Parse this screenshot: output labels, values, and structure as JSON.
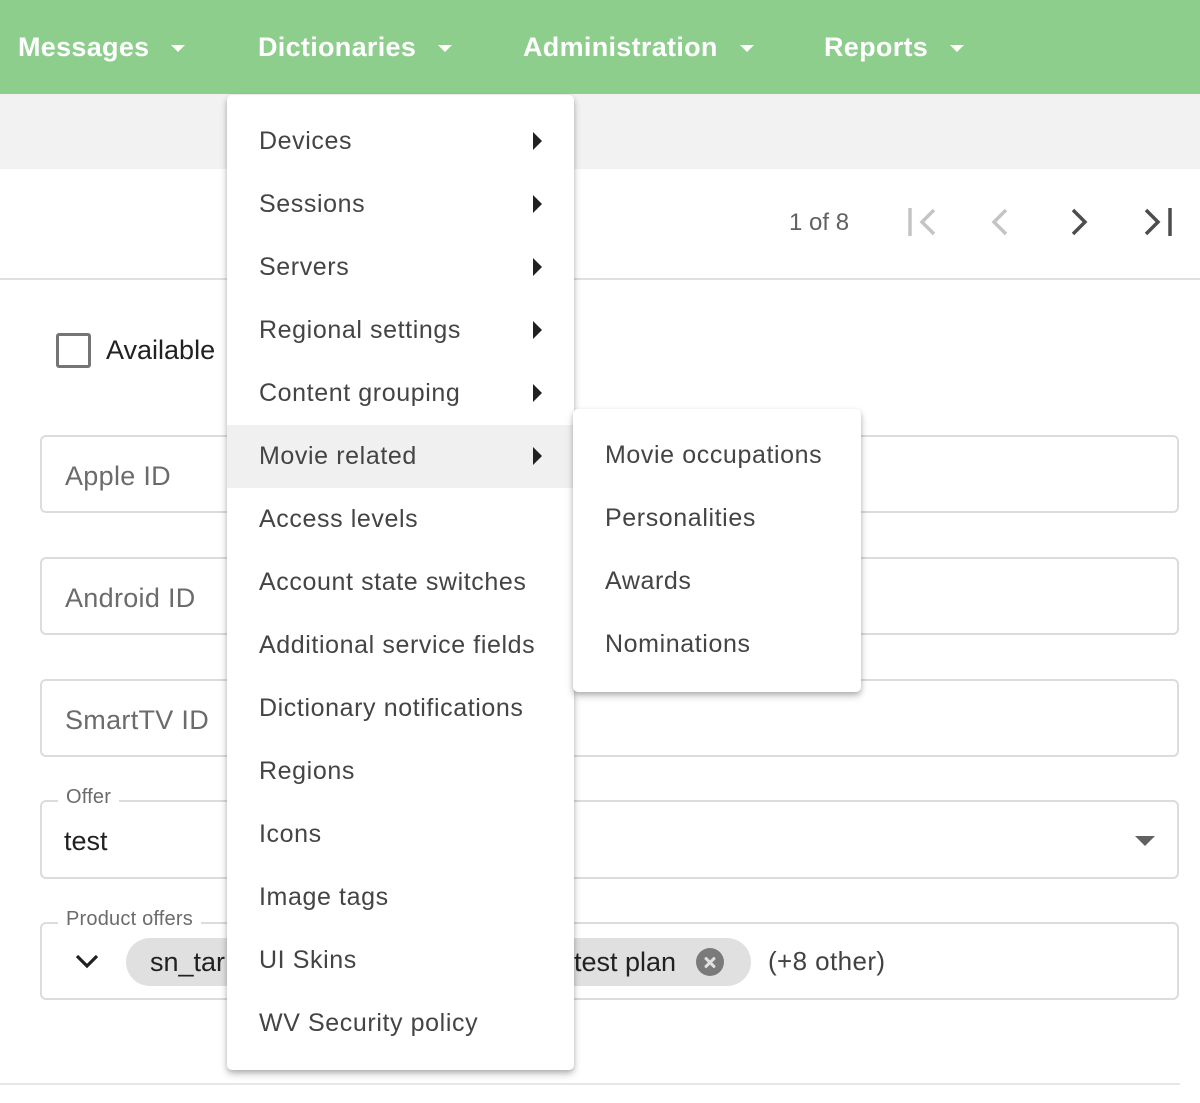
{
  "nav": {
    "items": [
      {
        "label": "Messages"
      },
      {
        "label": "Dictionaries"
      },
      {
        "label": "Administration"
      },
      {
        "label": "Reports"
      }
    ]
  },
  "paginator": {
    "label": "1 of 8",
    "icons": [
      "first-page-icon",
      "previous-page-icon",
      "next-page-icon",
      "last-page-icon"
    ]
  },
  "form": {
    "available_label": "Available",
    "available_checked": false,
    "apple_id_placeholder": "Apple ID",
    "android_id_placeholder": "Android ID",
    "smarttv_id_placeholder": "SmartTV ID",
    "offer": {
      "label": "Offer",
      "value": "test"
    },
    "product_offers": {
      "label": "Product offers",
      "chips": [
        {
          "label": "sn_tar"
        },
        {
          "label": "test plan"
        }
      ],
      "more": "(+8 other)"
    }
  },
  "dictionaries_menu": {
    "items": [
      {
        "label": "Devices",
        "has_submenu": true
      },
      {
        "label": "Sessions",
        "has_submenu": true
      },
      {
        "label": "Servers",
        "has_submenu": true
      },
      {
        "label": "Regional settings",
        "has_submenu": true
      },
      {
        "label": "Content grouping",
        "has_submenu": true
      },
      {
        "label": "Movie related",
        "has_submenu": true,
        "active": true
      },
      {
        "label": "Access levels"
      },
      {
        "label": "Account state switches"
      },
      {
        "label": "Additional service fields"
      },
      {
        "label": "Dictionary notifications"
      },
      {
        "label": "Regions"
      },
      {
        "label": "Icons"
      },
      {
        "label": "Image tags"
      },
      {
        "label": "UI Skins"
      },
      {
        "label": "WV Security policy"
      }
    ]
  },
  "movie_related_submenu": {
    "items": [
      {
        "label": "Movie occupations"
      },
      {
        "label": "Personalities"
      },
      {
        "label": "Awards"
      },
      {
        "label": "Nominations"
      }
    ]
  },
  "colors": {
    "nav_bg": "#8dce8d",
    "nav_text": "#ffffff",
    "active_menu_bg": "#f0f0f0"
  }
}
